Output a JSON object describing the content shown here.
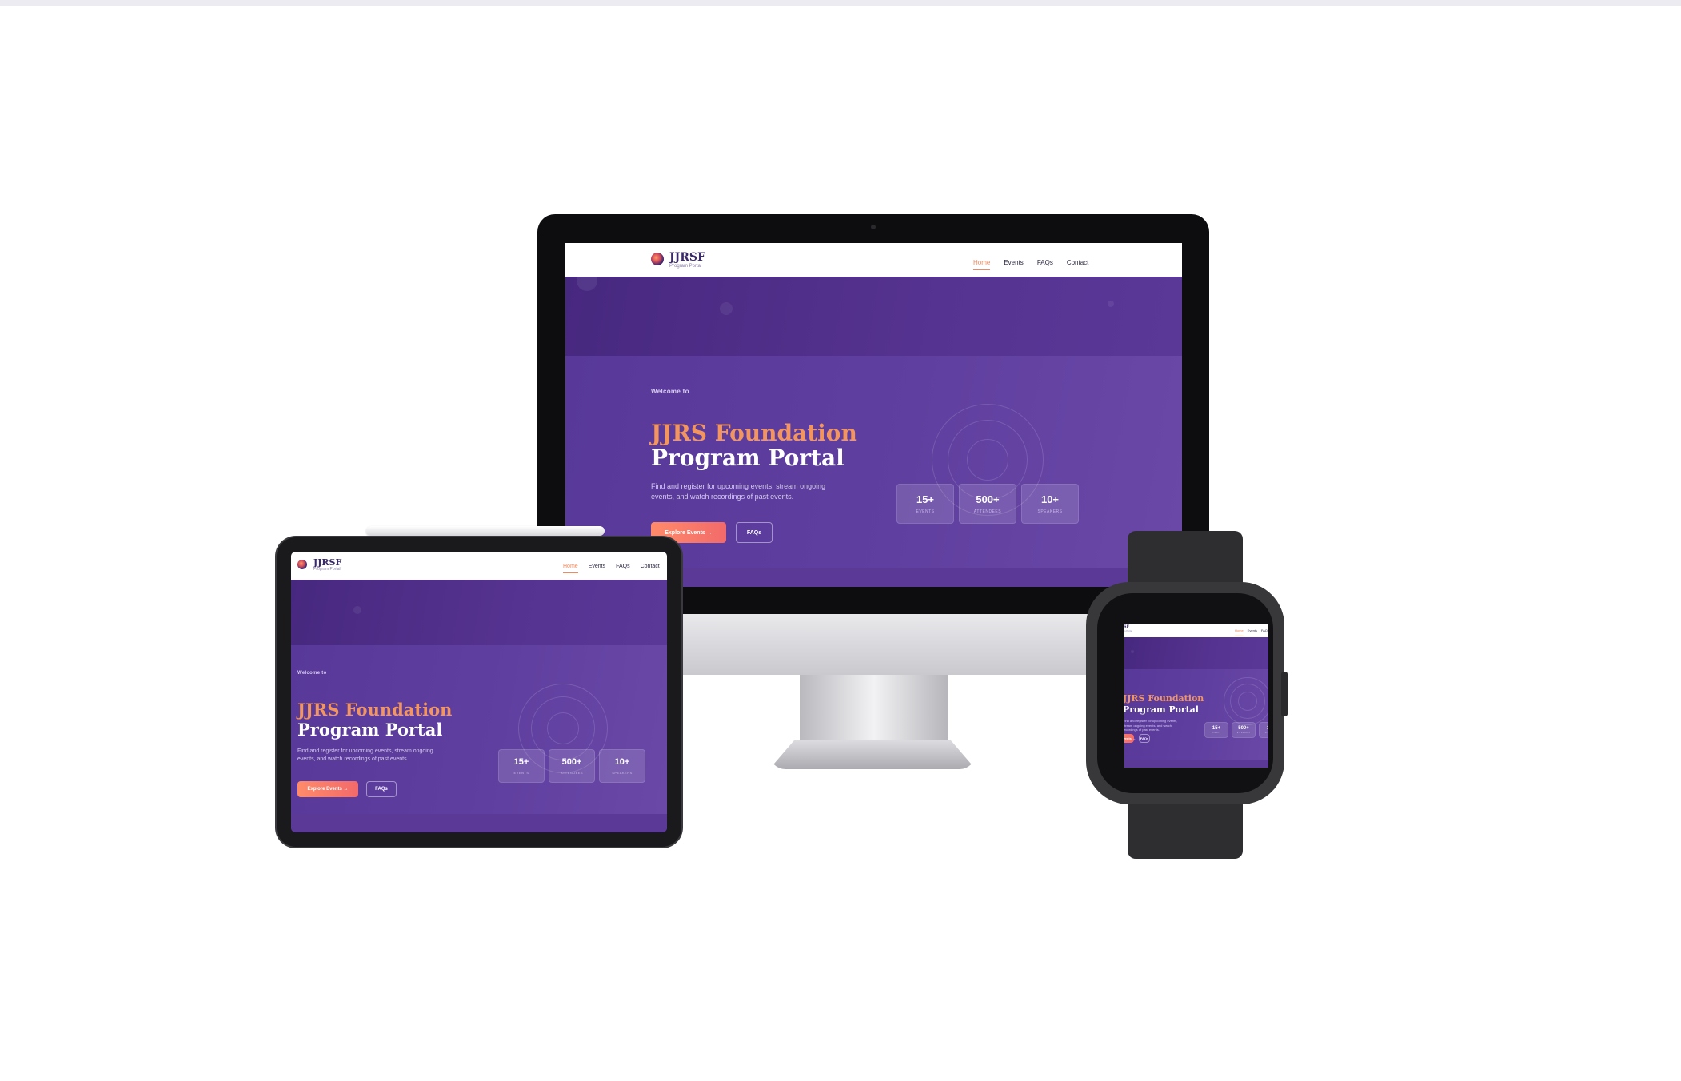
{
  "site": {
    "brand": {
      "name": "JJRSF",
      "subtitle": "Program Portal"
    },
    "nav": [
      "Home",
      "Events",
      "FAQs",
      "Contact"
    ],
    "active_nav": "Home",
    "hero": {
      "eyebrow": "Welcome to",
      "title_line1": "JJRS Foundation",
      "title_line2": "Program Portal",
      "description": "Find and register for upcoming events, stream ongoing events, and watch recordings of past events.",
      "primary_cta": "Explore Events →",
      "secondary_cta": "FAQs"
    },
    "stats": [
      {
        "value": "15+",
        "label": "EVENTS"
      },
      {
        "value": "500+",
        "label": "ATTENDEES"
      },
      {
        "value": "10+",
        "label": "SPEAKERS"
      }
    ]
  },
  "colors": {
    "brand_purple": "#5a3b93",
    "accent_orange": "#f2955f",
    "cta_gradient": [
      "#ff8b6a",
      "#f26a6a"
    ]
  },
  "devices": [
    "desktop-monitor",
    "tablet",
    "smartwatch"
  ]
}
